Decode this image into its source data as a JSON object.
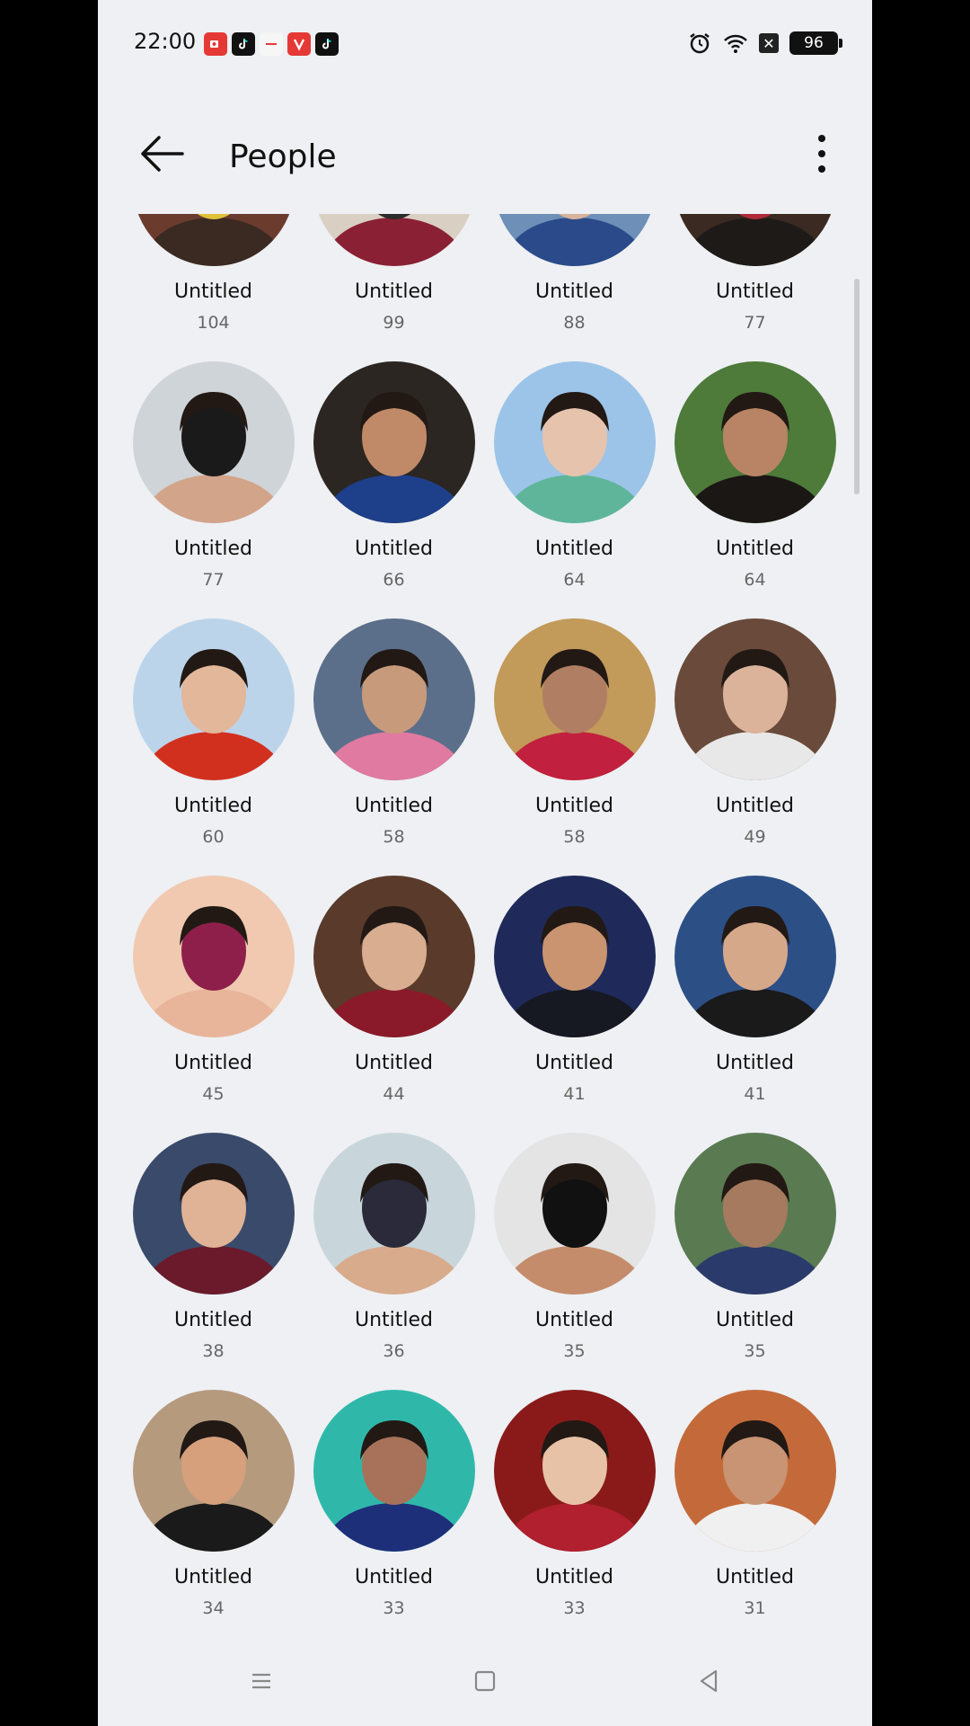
{
  "status_bar": {
    "time": "22:00",
    "battery": "96",
    "notification_icons": [
      "screen-recorder-icon",
      "tiktok-icon",
      "app-icon",
      "vivaldi-icon",
      "tiktok-icon"
    ],
    "system_icons": [
      "alarm-icon",
      "wifi-icon",
      "no-sim-icon",
      "battery-icon"
    ]
  },
  "app_bar": {
    "title": "People"
  },
  "people": [
    {
      "name": "Untitled",
      "count": "104",
      "colors": [
        "#6b3c2e",
        "#e0c13a",
        "#3a2a22"
      ]
    },
    {
      "name": "Untitled",
      "count": "99",
      "colors": [
        "#d9cfc2",
        "#2b2b2b",
        "#8a2033"
      ]
    },
    {
      "name": "Untitled",
      "count": "88",
      "colors": [
        "#6d8fb8",
        "#d6b39a",
        "#2a4a8a"
      ]
    },
    {
      "name": "Untitled",
      "count": "77",
      "colors": [
        "#3a2a22",
        "#b02a3a",
        "#1e1a18"
      ]
    },
    {
      "name": "Untitled",
      "count": "77",
      "colors": [
        "#cfd4d8",
        "#1a1a1a",
        "#d2a48a"
      ]
    },
    {
      "name": "Untitled",
      "count": "66",
      "colors": [
        "#2b2622",
        "#c08a68",
        "#1e3f8a"
      ]
    },
    {
      "name": "Untitled",
      "count": "64",
      "colors": [
        "#9cc4e8",
        "#e6c3ad",
        "#5fb59a"
      ]
    },
    {
      "name": "Untitled",
      "count": "64",
      "colors": [
        "#4e7a3a",
        "#b98466",
        "#1b1714"
      ]
    },
    {
      "name": "Untitled",
      "count": "60",
      "colors": [
        "#bcd4ea",
        "#e2b79a",
        "#d2301f"
      ]
    },
    {
      "name": "Untitled",
      "count": "58",
      "colors": [
        "#5c6f8a",
        "#c89a7c",
        "#e07aa0"
      ]
    },
    {
      "name": "Untitled",
      "count": "58",
      "colors": [
        "#c29a5a",
        "#b07e62",
        "#c1203e"
      ]
    },
    {
      "name": "Untitled",
      "count": "49",
      "colors": [
        "#6a4a3a",
        "#dbb39a",
        "#e8e8e8"
      ]
    },
    {
      "name": "Untitled",
      "count": "45",
      "colors": [
        "#f0c9b0",
        "#8e1f4a",
        "#e8b59a"
      ]
    },
    {
      "name": "Untitled",
      "count": "44",
      "colors": [
        "#5a3a2a",
        "#d8ad90",
        "#8a1a2a"
      ]
    },
    {
      "name": "Untitled",
      "count": "41",
      "colors": [
        "#1f2a5a",
        "#c9946f",
        "#161822"
      ]
    },
    {
      "name": "Untitled",
      "count": "41",
      "colors": [
        "#2c4f86",
        "#d6a88a",
        "#1a1a1a"
      ]
    },
    {
      "name": "Untitled",
      "count": "38",
      "colors": [
        "#3a4a6a",
        "#e0b396",
        "#6a1a2a"
      ]
    },
    {
      "name": "Untitled",
      "count": "36",
      "colors": [
        "#c8d6dc",
        "#2a2a3a",
        "#d8ab8c"
      ]
    },
    {
      "name": "Untitled",
      "count": "35",
      "colors": [
        "#e4e4e4",
        "#111111",
        "#c48c6a"
      ]
    },
    {
      "name": "Untitled",
      "count": "35",
      "colors": [
        "#5a7a52",
        "#a57a5e",
        "#2a3a6a"
      ]
    },
    {
      "name": "Untitled",
      "count": "34",
      "colors": [
        "#b59a7e",
        "#d6a07c",
        "#1a1a1a"
      ]
    },
    {
      "name": "Untitled",
      "count": "33",
      "colors": [
        "#2fb8aa",
        "#a8725a",
        "#1e2f7a"
      ]
    },
    {
      "name": "Untitled",
      "count": "33",
      "colors": [
        "#8a1a1a",
        "#e8c2a6",
        "#b0202e"
      ]
    },
    {
      "name": "Untitled",
      "count": "31",
      "colors": [
        "#c46a3a",
        "#c99474",
        "#f0f0f0"
      ]
    }
  ],
  "nav_bar": {
    "buttons": [
      "menu-icon",
      "home-icon",
      "back-icon"
    ]
  }
}
